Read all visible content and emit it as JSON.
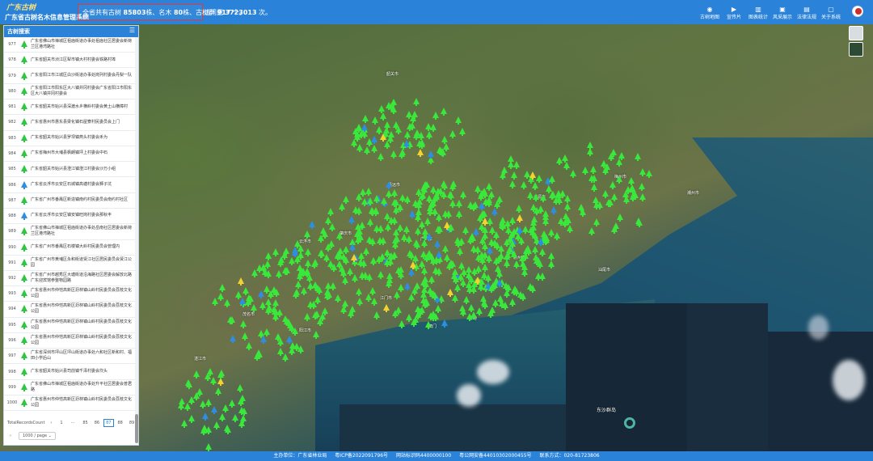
{
  "header": {
    "logo_mark": "广东古树",
    "logo_title": "广东省古树名木信息管理系统",
    "stats_prefix": "全省共有古树 ",
    "stats_trees": "85803",
    "stats_unit1": "株、名木 ",
    "stats_famous": "80",
    "stats_unit2": "株、古树群 ",
    "stats_groups": "917",
    "stats_unit3": " 个。",
    "visits_label": "访问量",
    "visits_value": "3723013",
    "visits_unit": " 次。",
    "nav": [
      {
        "icon": "globe-icon",
        "glyph": "◉",
        "label": "古树地图"
      },
      {
        "icon": "video-icon",
        "glyph": "▶",
        "label": "宣传片"
      },
      {
        "icon": "chart-icon",
        "glyph": "▥",
        "label": "图表统计"
      },
      {
        "icon": "image-icon",
        "glyph": "▣",
        "label": "风采展示"
      },
      {
        "icon": "document-icon",
        "glyph": "▤",
        "label": "法律法规"
      },
      {
        "icon": "info-icon",
        "glyph": "▢",
        "label": "关于系统"
      }
    ]
  },
  "panel": {
    "title": "古树搜索",
    "rows": [
      {
        "no": "977",
        "text": "广东省佛山市禅城区祖庙街道办事处祖庙社区居委会新荷兰区港湾路社",
        "color": "#2ec840"
      },
      {
        "no": "978",
        "text": "广东省韶关市浈江区犁市镇大村村委会铁路村埠",
        "color": "#2ec840"
      },
      {
        "no": "979",
        "text": "广东省阳江市江城区白沙街道办事处岗列村委会丹梨一队",
        "color": "#2ec840"
      },
      {
        "no": "980",
        "text": "广东省阳江市阳东区大八镇井冈村委会广东省阳江市阳东区大八镇井冈村委会",
        "color": "#2ec840"
      },
      {
        "no": "981",
        "text": "广东省韶关市始兴县深渡水乡横岭村委会黄土山横樟村",
        "color": "#2ec840"
      },
      {
        "no": "982",
        "text": "广东省惠州市惠东县梁化镇石屋寮村民委员会上门",
        "color": "#2ec840"
      },
      {
        "no": "983",
        "text": "广东省韶关市始兴县罗坝镇燕头村委会禾为",
        "color": "#2ec840"
      },
      {
        "no": "984",
        "text": "广东省梅州市大埔县枫朗镇坪上村委会中石",
        "color": "#2ec840"
      },
      {
        "no": "985",
        "text": "广东省韶关市始兴县澄江镇澄江村委会沙万小组",
        "color": "#2ec840"
      },
      {
        "no": "986",
        "text": "广东省云浮市云安区石城镇高塘村委会狮子坑",
        "color": "#2e8fe0"
      },
      {
        "no": "987",
        "text": "广东省广州市番禺区新造镇南约村民委员会南约村社区",
        "color": "#2ec840"
      },
      {
        "no": "988",
        "text": "广东省云浮市云安区镇安镇旺岗村委会那秋丰",
        "color": "#2e8fe0"
      },
      {
        "no": "989",
        "text": "广东省佛山市禅城区祖庙街道办事处岳南社区居委会新荷兰区港湾路社",
        "color": "#2ec840"
      },
      {
        "no": "990",
        "text": "广东省广州市番禺区石楼镇大岭村民委员会管理内",
        "color": "#2ec840"
      },
      {
        "no": "991",
        "text": "广东省广州市黄埔区永和街道贤江社区居民委员会贤江公园",
        "color": "#2ec840"
      },
      {
        "no": "992",
        "text": "广东省广州市越秀区大塘街道沿海路社区居委会解放北路广东迎宾馆参整物园路",
        "color": "#2ec840"
      },
      {
        "no": "993",
        "text": "广东省惠州市仲恺高新区沥林镇山岭村民委员会荔枝文化公园",
        "color": "#2ec840"
      },
      {
        "no": "994",
        "text": "广东省惠州市仲恺高新区沥林镇山岭村民委员会荔枝文化公园",
        "color": "#2ec840"
      },
      {
        "no": "995",
        "text": "广东省惠州市仲恺高新区沥林镇山岭村民委员会荔枝文化公园",
        "color": "#2ec840"
      },
      {
        "no": "996",
        "text": "广东省惠州市仲恺高新区沥林镇山岭村民委员会荔枝文化公园",
        "color": "#2ec840"
      },
      {
        "no": "997",
        "text": "广东省深圳市坪山区坪山街道办事处六和社区新和村、福田小学后山",
        "color": "#2ec840"
      },
      {
        "no": "998",
        "text": "广东省韶关市始兴县司前镇千泽村委会坎头",
        "color": "#2ec840"
      },
      {
        "no": "999",
        "text": "广东省佛山市禅城区祖庙街道办事处升平社区居委会普君路",
        "color": "#2ec840"
      },
      {
        "no": "1000",
        "text": "广东省惠州市仲恺高新区沥林镇山岭村民委员会荔枝文化公园",
        "color": "#2ec840"
      }
    ],
    "pager": {
      "total_label": "TotalRecordsCount",
      "prev": "‹",
      "first": "1",
      "ellipsis": "···",
      "pages": [
        "85",
        "86",
        "87",
        "88",
        "89"
      ],
      "active": "87",
      "next": "›",
      "per_page": "1000 / page ⌄"
    }
  },
  "map": {
    "cities": [
      "韶关市",
      "梅州市",
      "潮州市",
      "清远市",
      "河源市",
      "广州市",
      "惠州市",
      "汕尾市",
      "肇庆市",
      "云浮市",
      "江门市",
      "阳江市",
      "茂名市",
      "湛江市",
      "香港",
      "澳门"
    ],
    "island_label": "东沙群岛",
    "marker_colors": {
      "green": "#39e83a",
      "blue": "#2e8fe0",
      "yellow": "#f2d22e"
    }
  },
  "footer": {
    "sponsor": "主办单位：广东省林业局",
    "icp": "粤ICP备2022091796号",
    "site_id": "网站标识码4400000100",
    "police": "粤公网安备44010302000455号",
    "contact": "联系方式：020-81723806"
  }
}
